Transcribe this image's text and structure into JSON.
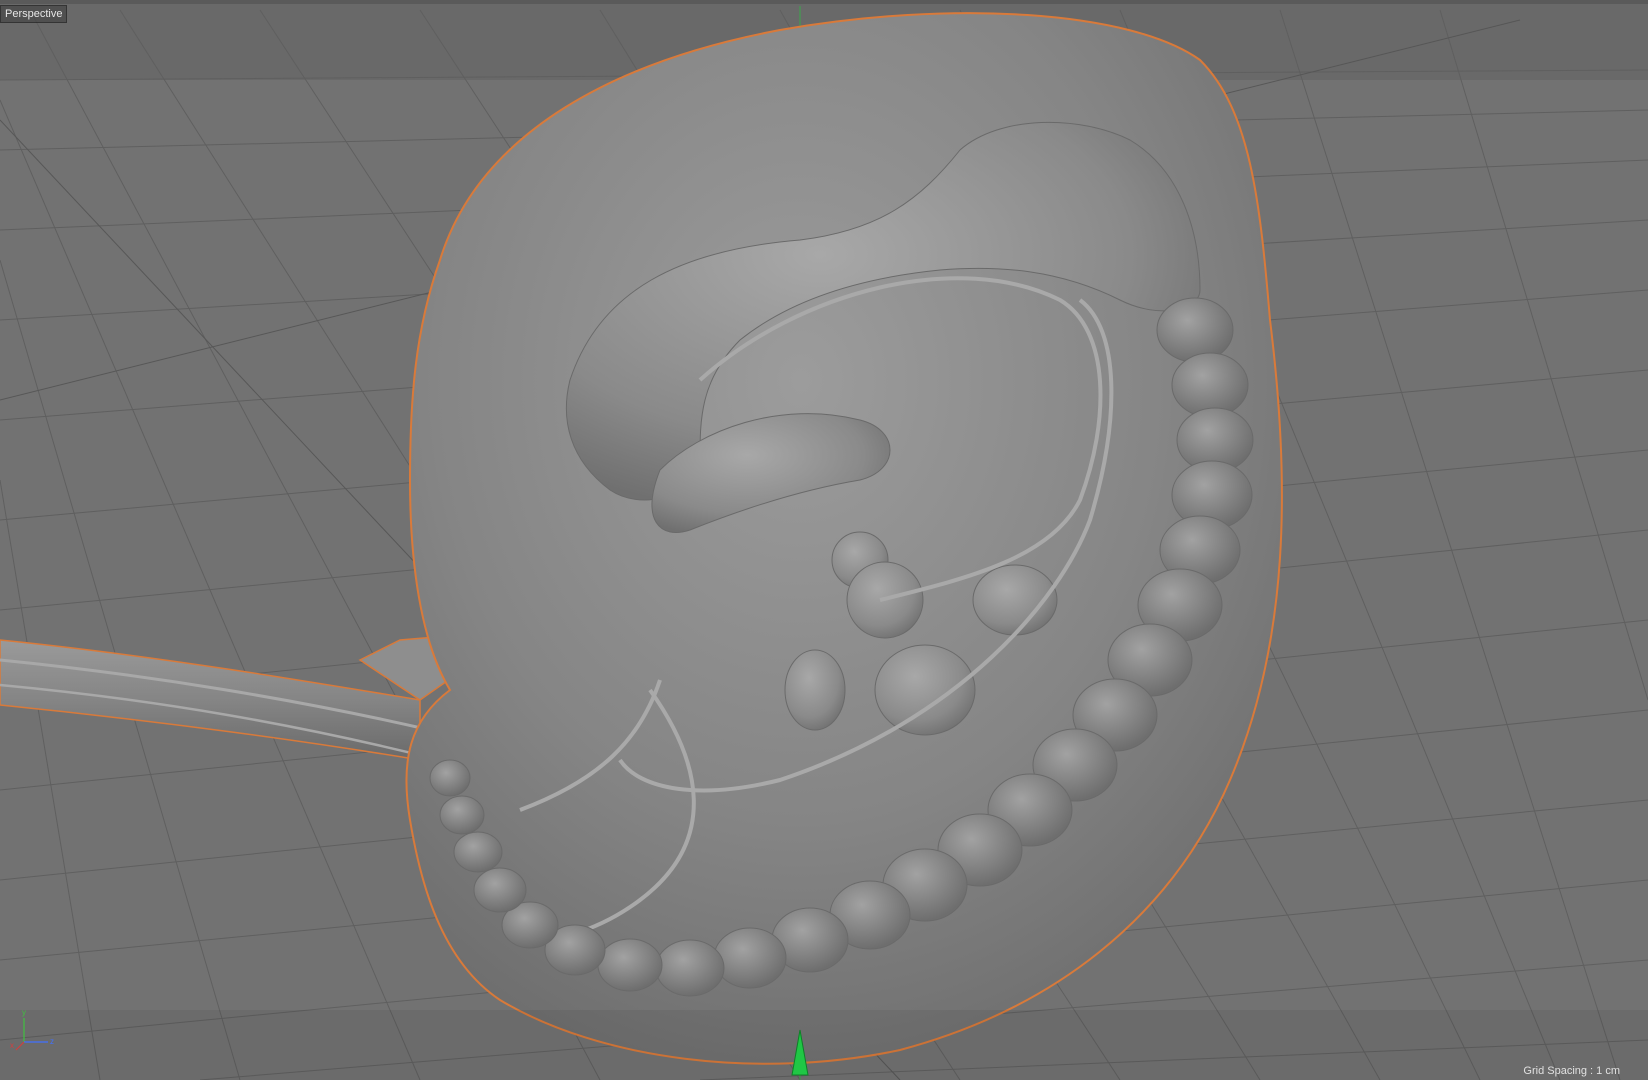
{
  "viewport": {
    "camera_label": "Perspective",
    "grid_spacing_label": "Grid Spacing : 1 cm",
    "axis": {
      "x_label": "x",
      "y_label": "y",
      "z_label": "z",
      "x_color": "#d04040",
      "y_color": "#40c040",
      "z_color": "#4070ff"
    },
    "selection_outline_color": "#d97a3a",
    "origin_marker_color": "#22d44a"
  }
}
